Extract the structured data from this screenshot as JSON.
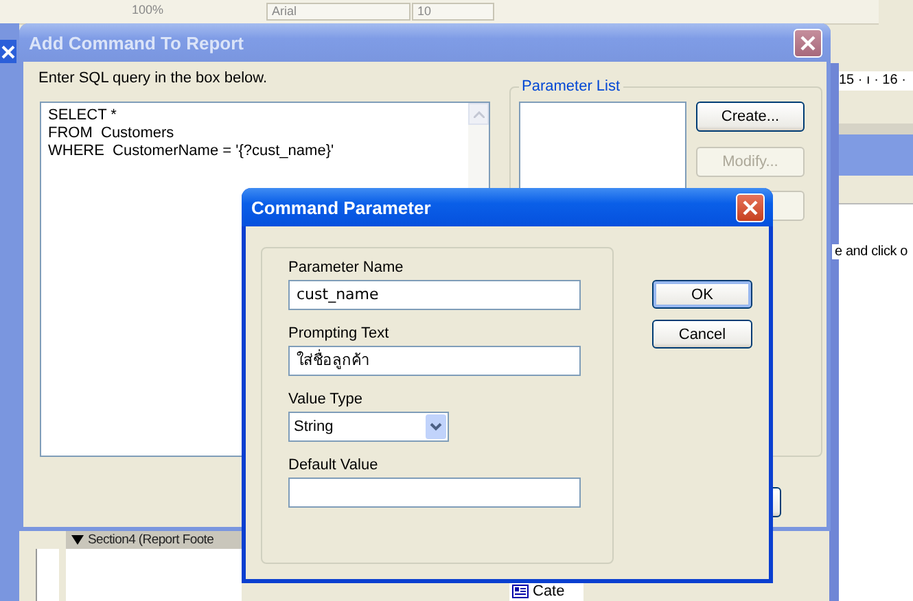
{
  "app_toolbar": {
    "zoom": "100%",
    "font": "Arial",
    "size": "10"
  },
  "background": {
    "ruler": "15 · ı · 16 ·",
    "hint": "e and click o",
    "section": "Section4 (Report Foote",
    "field_item": "Cate"
  },
  "add_command_dialog": {
    "title": "Add Command To Report",
    "instruction": "Enter SQL query in the box below.",
    "query": "SELECT *\nFROM  Customers\nWHERE  CustomerName = '{?cust_name}'",
    "parameter_list": {
      "label": "Parameter List",
      "buttons": [
        {
          "label": "Create...",
          "disabled": false
        },
        {
          "label": "Modify...",
          "disabled": true
        }
      ]
    }
  },
  "command_parameter_dialog": {
    "title": "Command Parameter",
    "fields": [
      {
        "label": "Parameter Name",
        "kind": "text",
        "value": "cust_name"
      },
      {
        "label": "Prompting Text",
        "kind": "text",
        "value": "ใส่ชื่อลูกค้า"
      },
      {
        "label": "Value Type",
        "kind": "select",
        "value": "String"
      },
      {
        "label": "Default Value",
        "kind": "text"
      }
    ],
    "buttons": [
      {
        "label": "OK",
        "default": true
      },
      {
        "label": "Cancel",
        "default": false
      }
    ]
  }
}
